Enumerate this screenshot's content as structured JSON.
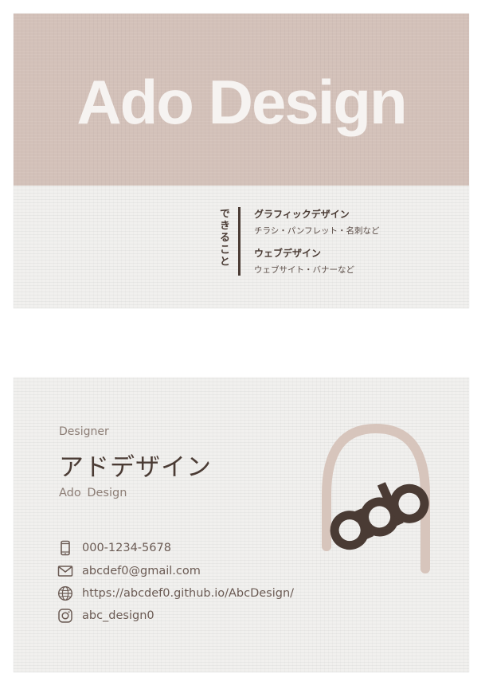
{
  "colors": {
    "band": "#d3c1b9",
    "paper": "#f1f0ee",
    "dark_brown": "#4a3b34",
    "muted_brown": "#8c7d75",
    "arch": "#d7c5bc",
    "title_white": "#f6f3f1"
  },
  "front": {
    "title": "Ado Design",
    "services_label": "できること",
    "services": [
      {
        "title": "グラフィックデザイン",
        "sub": "チラシ・パンフレット・名刺など"
      },
      {
        "title": "ウェブデザイン",
        "sub": "ウェブサイト・バナーなど"
      }
    ]
  },
  "back": {
    "role": "Designer",
    "name_jp": "アドデザイン",
    "name_en": "Ado  Design",
    "contacts": [
      {
        "icon": "smartphone-icon",
        "text": "000-1234-5678"
      },
      {
        "icon": "mail-icon",
        "text": "abcdef0@gmail.com"
      },
      {
        "icon": "globe-icon",
        "text": "https://abcdef0.github.io/AbcDesign/"
      },
      {
        "icon": "instagram-icon",
        "text": "abc_design0"
      }
    ],
    "logo_text": "ado"
  }
}
